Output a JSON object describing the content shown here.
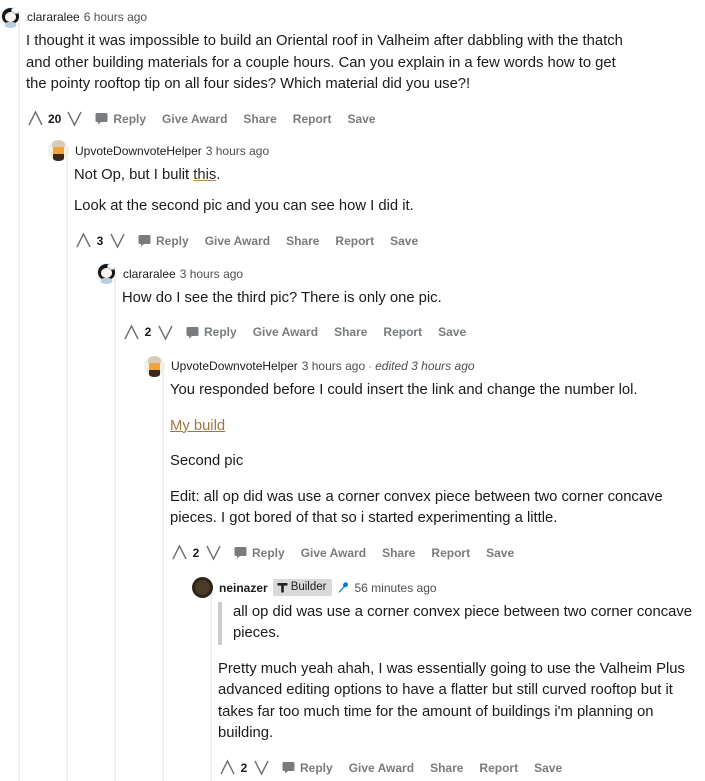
{
  "theme": {
    "text": "#1a1a1b",
    "meta": "#4f4f4f",
    "action": "#787c7e",
    "threadline": "#edeff1",
    "link_orange": "#a0763f",
    "flair_bg": "#d9d9d9",
    "op_blue": "#0079d3"
  },
  "action_labels": {
    "reply": "Reply",
    "give_award": "Give Award",
    "share": "Share",
    "report": "Report",
    "save": "Save"
  },
  "icons": {
    "upvote": "upvote-arrow-icon",
    "downvote": "downvote-arrow-icon",
    "comment": "comment-bubble-icon",
    "flair": "hammer-icon",
    "op": "microphone-icon"
  },
  "comments": [
    {
      "id": "c1",
      "depth": 0,
      "author": "clararalee",
      "author_bold": false,
      "timestamp": "6 hours ago",
      "edited": "",
      "avatar": "av-clara",
      "flair": "",
      "is_op": false,
      "score": "20",
      "paragraphs": [
        "I thought it was impossible to build an Oriental roof in Valheim after dabbling with the thatch and other building materials for a couple hours. Can you explain in a few words how to get the pointy rooftop tip on all four sides? Which material did you use?!"
      ]
    },
    {
      "id": "c2",
      "depth": 1,
      "author": "UpvoteDownvoteHelper",
      "author_bold": false,
      "timestamp": "3 hours ago",
      "edited": "",
      "avatar": "av-helper",
      "flair": "",
      "is_op": false,
      "score": "3",
      "paragraphs": [
        "Not Op, but I bulit this.",
        "Look at the second pic and you can see how I did it."
      ],
      "link_text": "this",
      "prefix_text": "Not Op, but I bulit ",
      "suffix_text": "."
    },
    {
      "id": "c3",
      "depth": 2,
      "author": "clararalee",
      "author_bold": false,
      "timestamp": "3 hours ago",
      "edited": "",
      "avatar": "av-clara",
      "flair": "",
      "is_op": false,
      "score": "2",
      "paragraphs": [
        "How do I see the third pic? There is only one pic."
      ]
    },
    {
      "id": "c4",
      "depth": 3,
      "author": "UpvoteDownvoteHelper",
      "author_bold": false,
      "timestamp": "3 hours ago",
      "edited": "edited 3 hours ago",
      "avatar": "av-helper",
      "flair": "",
      "is_op": false,
      "score": "2",
      "paragraphs": [
        "You responded before I could insert the link and change the number lol.",
        "Second pic",
        "Edit: all op did was use a corner convex piece between two corner concave pieces. I got bored of that so i started experimenting a little."
      ],
      "build_link": "My build"
    },
    {
      "id": "c5",
      "depth": 4,
      "author": "neinazer",
      "author_bold": true,
      "timestamp": "56 minutes ago",
      "edited": "",
      "avatar": "av-nein",
      "flair": "Builder",
      "is_op": true,
      "score": "2",
      "quote": "all op did was use a corner convex piece between two corner concave pieces.",
      "paragraphs": [
        "Pretty much yeah ahah, I was essentially going to use the Valheim Plus advanced editing options to have a flatter but still curved rooftop but it takes far too much time for the amount of buildings i'm planning on building."
      ]
    }
  ]
}
